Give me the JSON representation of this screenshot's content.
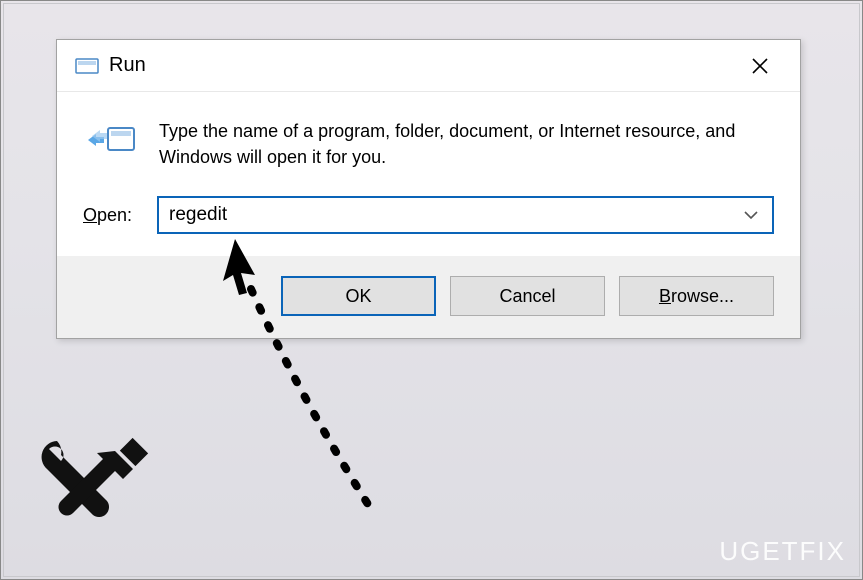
{
  "dialog": {
    "title": "Run",
    "prompt": "Type the name of a program, folder, document, or Internet resource, and Windows will open it for you.",
    "open_label_prefix": "O",
    "open_label_rest": "pen:",
    "input_value": "regedit",
    "buttons": {
      "ok": "OK",
      "cancel": "Cancel",
      "browse_prefix": "B",
      "browse_rest": "rowse..."
    }
  },
  "watermark": "UGETFIX"
}
